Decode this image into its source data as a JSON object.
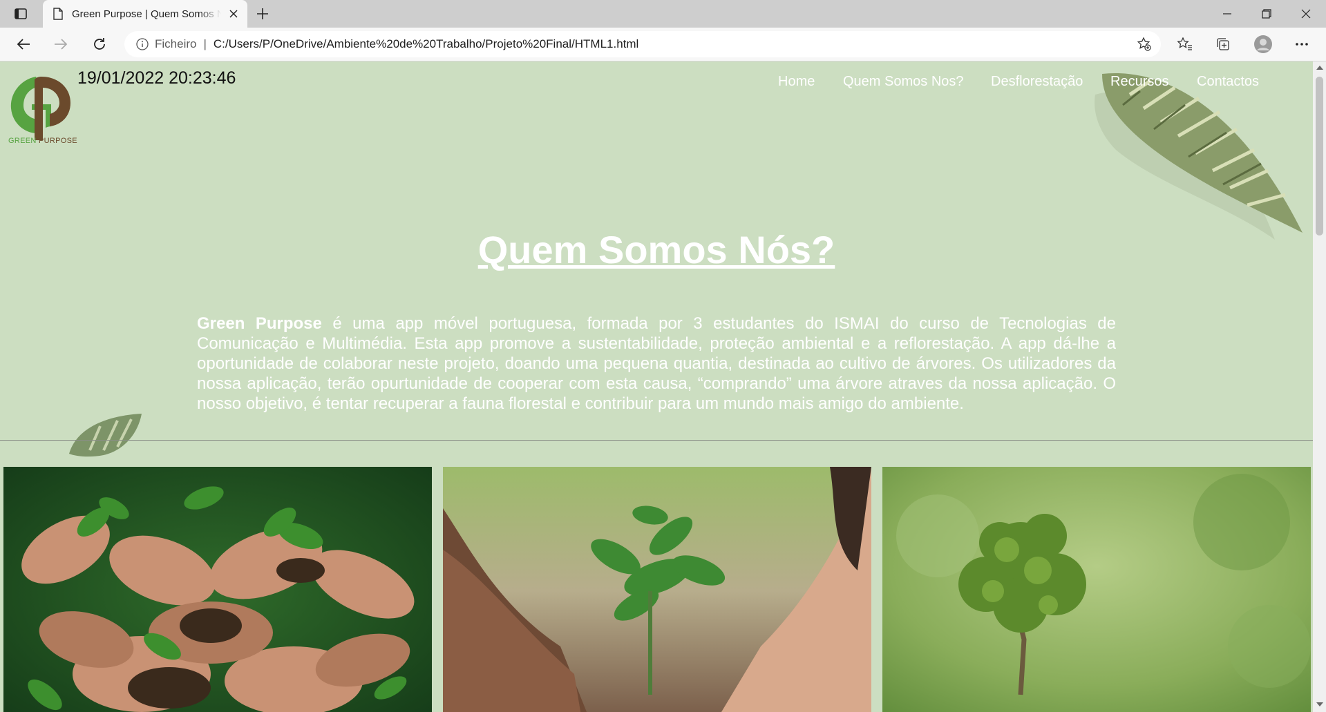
{
  "browser": {
    "tab_title": "Green Purpose | Quem Somos Nós?",
    "address_scheme": "Ficheiro",
    "address_separator": "|",
    "url": "C:/Users/P/OneDrive/Ambiente%20de%20Trabalho/Projeto%20Final/HTML1.html"
  },
  "page": {
    "logo_text_green": "GREEN",
    "logo_text_brown": "PURPOSE",
    "datetime": "19/01/2022 20:23:46",
    "nav": [
      "Home",
      "Quem Somos Nos?",
      "Desflorestação",
      "Recursos",
      "Contactos"
    ],
    "title": "Quem Somos Nós?",
    "intro_bold": "Green Purpose",
    "intro_text": " é uma app móvel portuguesa, formada por 3 estudantes do ISMAI do curso de Tecnologias de Comunicação e Multimédia. Esta app promove a sustentabilidade, proteção ambiental e a reflorestação. A app dá-lhe a oportunidade de colaborar neste projeto, doando uma pequena quantia, destinada ao cultivo de árvores. Os utilizadores da nossa aplicação, terão opurtunidade de cooperar com esta causa, “comprando” uma árvore atraves da nossa aplicação. O nosso objetivo, é tentar recuperar a fauna florestal e contribuir para um mundo mais amigo do ambiente."
  },
  "icons": [
    "tab-actions-icon",
    "page-icon",
    "close-icon",
    "plus-icon",
    "minimize-icon",
    "restore-icon",
    "window-close-icon",
    "back-icon",
    "forward-icon",
    "refresh-icon",
    "info-icon",
    "add-favorite-icon",
    "favorites-icon",
    "collections-icon",
    "profile-icon",
    "more-icon"
  ],
  "colors": {
    "page_bg": "#ccdec1",
    "logo_green": "#57a341",
    "logo_brown": "#6b4a2c"
  }
}
